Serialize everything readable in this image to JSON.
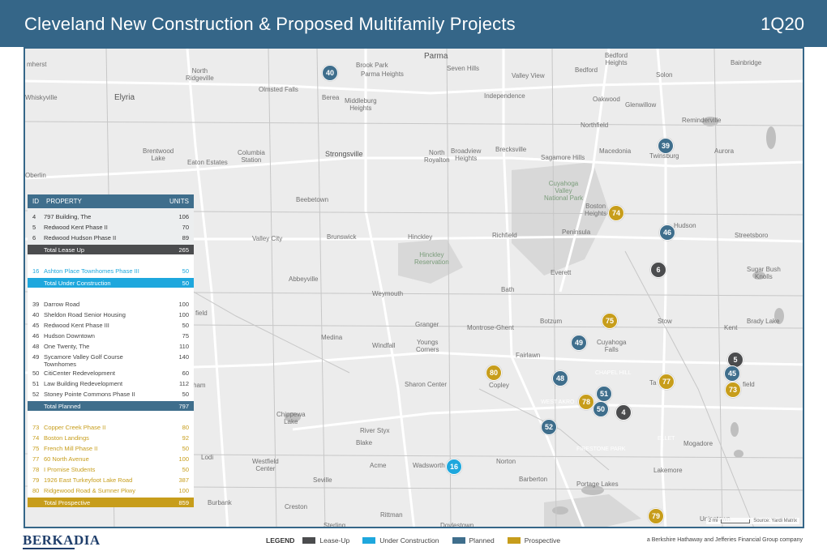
{
  "header": {
    "title": "Cleveland New Construction & Proposed Multifamily Projects",
    "period": "1Q20"
  },
  "table": {
    "headers": {
      "id": "ID",
      "property": "PROPERTY",
      "units": "UNITS"
    },
    "lease_up": {
      "rows": [
        {
          "id": "4",
          "property": "797 Building, The",
          "units": "106"
        },
        {
          "id": "5",
          "property": "Redwood Kent Phase II",
          "units": "70"
        },
        {
          "id": "6",
          "property": "Redwood Hudson Phase II",
          "units": "89"
        }
      ],
      "total_label": "Total Lease Up",
      "total_units": "265"
    },
    "under_construction": {
      "rows": [
        {
          "id": "16",
          "property": "Ashton Place Townhomes Phase III",
          "units": "50"
        }
      ],
      "total_label": "Total Under Construction",
      "total_units": "50"
    },
    "planned": {
      "rows": [
        {
          "id": "39",
          "property": "Darrow Road",
          "units": "100"
        },
        {
          "id": "40",
          "property": "Sheldon Road Senior Housing",
          "units": "100"
        },
        {
          "id": "45",
          "property": "Redwood Kent Phase III",
          "units": "50"
        },
        {
          "id": "46",
          "property": "Hudson Downtown",
          "units": "75"
        },
        {
          "id": "48",
          "property": "One Twenty, The",
          "units": "110"
        },
        {
          "id": "49",
          "property": "Sycamore Valley Golf Course\nTownhomes",
          "units": "140"
        },
        {
          "id": "50",
          "property": "CitiCenter Redevelopment",
          "units": "60"
        },
        {
          "id": "51",
          "property": "Law Building Redevelopment",
          "units": "112"
        },
        {
          "id": "52",
          "property": "Stoney Pointe Commons Phase II",
          "units": "50"
        }
      ],
      "total_label": "Total Planned",
      "total_units": "797"
    },
    "prospective": {
      "rows": [
        {
          "id": "73",
          "property": "Copper Creek Phase II",
          "units": "80"
        },
        {
          "id": "74",
          "property": "Boston Landings",
          "units": "92"
        },
        {
          "id": "75",
          "property": "French Mill Phase II",
          "units": "50"
        },
        {
          "id": "77",
          "property": "60 North Avenue",
          "units": "100"
        },
        {
          "id": "78",
          "property": "I Promise Students",
          "units": "50"
        },
        {
          "id": "79",
          "property": "1926 East Turkeyfoot Lake Road",
          "units": "387"
        },
        {
          "id": "80",
          "property": "Ridgewood Road & Sumner Pkwy",
          "units": "100"
        }
      ],
      "total_label": "Total Prospective",
      "total_units": "859"
    }
  },
  "markers": [
    {
      "id": "40",
      "status": "planned"
    },
    {
      "id": "39",
      "status": "planned"
    },
    {
      "id": "74",
      "status": "prospective"
    },
    {
      "id": "46",
      "status": "planned"
    },
    {
      "id": "6",
      "status": "lease"
    },
    {
      "id": "75",
      "status": "prospective"
    },
    {
      "id": "49",
      "status": "planned"
    },
    {
      "id": "5",
      "status": "lease"
    },
    {
      "id": "45",
      "status": "planned"
    },
    {
      "id": "80",
      "status": "prospective"
    },
    {
      "id": "48",
      "status": "planned"
    },
    {
      "id": "77",
      "status": "prospective"
    },
    {
      "id": "73",
      "status": "prospective"
    },
    {
      "id": "51",
      "status": "planned"
    },
    {
      "id": "78",
      "status": "prospective"
    },
    {
      "id": "50",
      "status": "planned"
    },
    {
      "id": "4",
      "status": "lease"
    },
    {
      "id": "52",
      "status": "planned"
    },
    {
      "id": "16",
      "status": "construction"
    },
    {
      "id": "79",
      "status": "prospective"
    }
  ],
  "places": {
    "parma": "Parma",
    "seven_hills": "Seven Hills",
    "bedford": "Bedford",
    "bedford_heights": "Bedford\nHeights",
    "bainbridge": "Bainbridge",
    "amherst": "mherst",
    "north_ridgeville": "North\nRidgeville",
    "brook_park": "Brook Park",
    "parma_heights": "Parma Heights",
    "valley_view": "Valley View",
    "solon": "Solon",
    "olmsted_falls": "Olmsted Falls",
    "elyria": "Elyria",
    "whiskyville": "Whiskyville",
    "berea": "Berea",
    "middleburg_heights": "Middleburg\nHeights",
    "independence": "Independence",
    "oakwood": "Oakwood",
    "glenwillow": "Glenwillow",
    "northfield": "Northfield",
    "reminderville": "Reminderville",
    "brentwood_lake": "Brentwood\nLake",
    "eaton_estates": "Eaton Estates",
    "columbia_station": "Columbia\nStation",
    "strongsville": "Strongsville",
    "north_royalton": "North\nRoyalton",
    "broadview_heights": "Broadview\nHeights",
    "brecksville": "Brecksville",
    "sagamore_hills": "Sagamore Hills",
    "macedonia": "Macedonia",
    "twinsburg": "Twinsburg",
    "aurora": "Aurora",
    "oberlin": "Oberlin",
    "cuyahoga_valley": "Cuyahoga\nValley\nNational Park",
    "beebetown": "Beebetown",
    "boston_heights": "Boston\nHeights",
    "hudson": "Hudson",
    "valley_city": "Valley City",
    "brunswick": "Brunswick",
    "hinckley": "Hinckley",
    "richfield": "Richfield",
    "peninsula": "Peninsula",
    "streetsboro": "Streetsboro",
    "hinckley_reservation": "Hinckley\nReservation",
    "everett": "Everett",
    "sugar_bush_knolls": "Sugar Bush\nKnolls",
    "abbeyville": "Abbeyville",
    "weymouth": "Weymouth",
    "bath": "Bath",
    "granger": "Granger",
    "montrose_ghent": "Montrose-Ghent",
    "botzum": "Botzum",
    "stow": "Stow",
    "kent": "Kent",
    "brady_lake": "Brady Lake",
    "medina": "Medina",
    "windfall": "Windfall",
    "youngs_corners": "Youngs\nCorners",
    "cuyahoga_falls": "Cuyahoga\nFalls",
    "fairlawn": "Fairlawn",
    "chapel_hill": "CHAPEL HILL",
    "sharon_center": "Sharon Center",
    "copley": "Copley",
    "tallmadge": "Ta",
    "west_akron": "WEST AKRO",
    "chippewa_lake": "Chippewa\nLake",
    "river_styx": "River Styx",
    "blake": "Blake",
    "ellet": "ELLET",
    "mogadore": "Mogadore",
    "lodi": "Lodi",
    "westfield_center": "Westfield\nCenter",
    "acme": "Acme",
    "wadsworth": "Wadsworth",
    "norton": "Norton",
    "firestone_park": "FIRESTONE PARK",
    "lakemore": "Lakemore",
    "seville": "Seville",
    "barberton": "Barberton",
    "portage_lakes": "Portage Lakes",
    "burbank": "Burbank",
    "creston": "Creston",
    "rittman": "Rittman",
    "doylestown": "Doylestown",
    "sterling": "Sterling",
    "uniontown": "Uniontown",
    "ham": "ham",
    "field": "field",
    "garfield": "field"
  },
  "scale": {
    "label": "2 mi",
    "source": "Source: Yardi Matrix"
  },
  "footer": {
    "logo": "BERKADIA",
    "legend_title": "LEGEND",
    "legend": [
      {
        "label": "Lease-Up",
        "color": "#4b4c4e"
      },
      {
        "label": "Under Construction",
        "color": "#1ea7dd"
      },
      {
        "label": "Planned",
        "color": "#3f6e8c"
      },
      {
        "label": "Prospective",
        "color": "#c79d1b"
      }
    ],
    "tagline": "a Berkshire Hathaway and Jefferies Financial Group company"
  },
  "colors": {
    "header": "#356688",
    "lease": "#4b4c4e",
    "construction": "#1ea7dd",
    "planned": "#3f6e8c",
    "prospective": "#c79d1b"
  }
}
